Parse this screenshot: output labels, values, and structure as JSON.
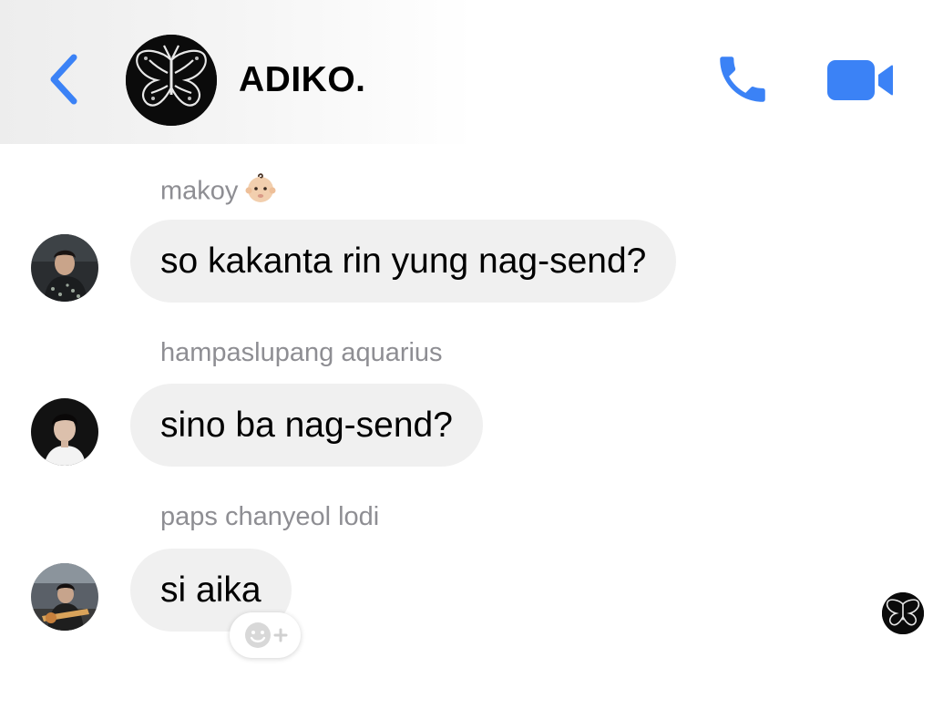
{
  "header": {
    "title": "ADIKO.",
    "back_icon": "chevron-left-icon",
    "call_icon": "phone-icon",
    "video_icon": "video-camera-icon",
    "accent_color": "#3b82f6"
  },
  "messages": [
    {
      "sender": "makoy",
      "sender_emoji": "baby-face-emoji",
      "text": "so kakanta rin yung nag-send?"
    },
    {
      "sender": "hampaslupang aquarius",
      "text": "sino ba nag-send?"
    },
    {
      "sender": "paps chanyeol lodi",
      "text": "si aika"
    }
  ],
  "reaction": {
    "icon": "add-reaction-icon"
  },
  "read_receipt": {
    "icon": "butterfly-avatar"
  },
  "colors": {
    "bubble": "#f0f0f0",
    "sender_name": "#8e8e93"
  }
}
